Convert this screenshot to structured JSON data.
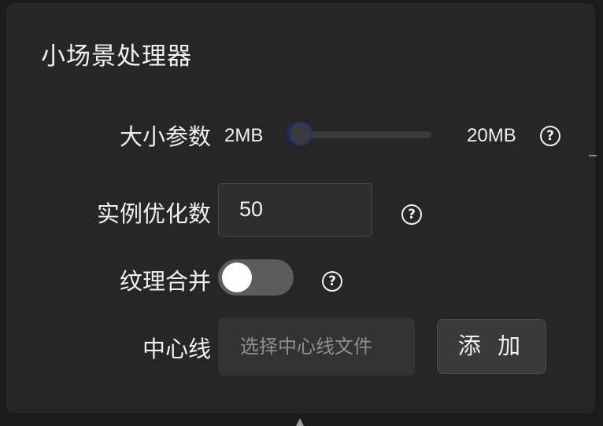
{
  "panel": {
    "title": "小场景处理器"
  },
  "size_param": {
    "label": "大小参数",
    "min_label": "2MB",
    "max_label": "20MB",
    "value_fraction": 0.05
  },
  "instance_opt": {
    "label": "实例优化数",
    "value": "50"
  },
  "texture_merge": {
    "label": "纹理合并",
    "enabled": false
  },
  "centerline": {
    "label": "中心线",
    "placeholder": "选择中心线文件",
    "add_label": "添 加"
  },
  "icons": {
    "help": "question-circle-icon",
    "help_glyph": "?"
  }
}
